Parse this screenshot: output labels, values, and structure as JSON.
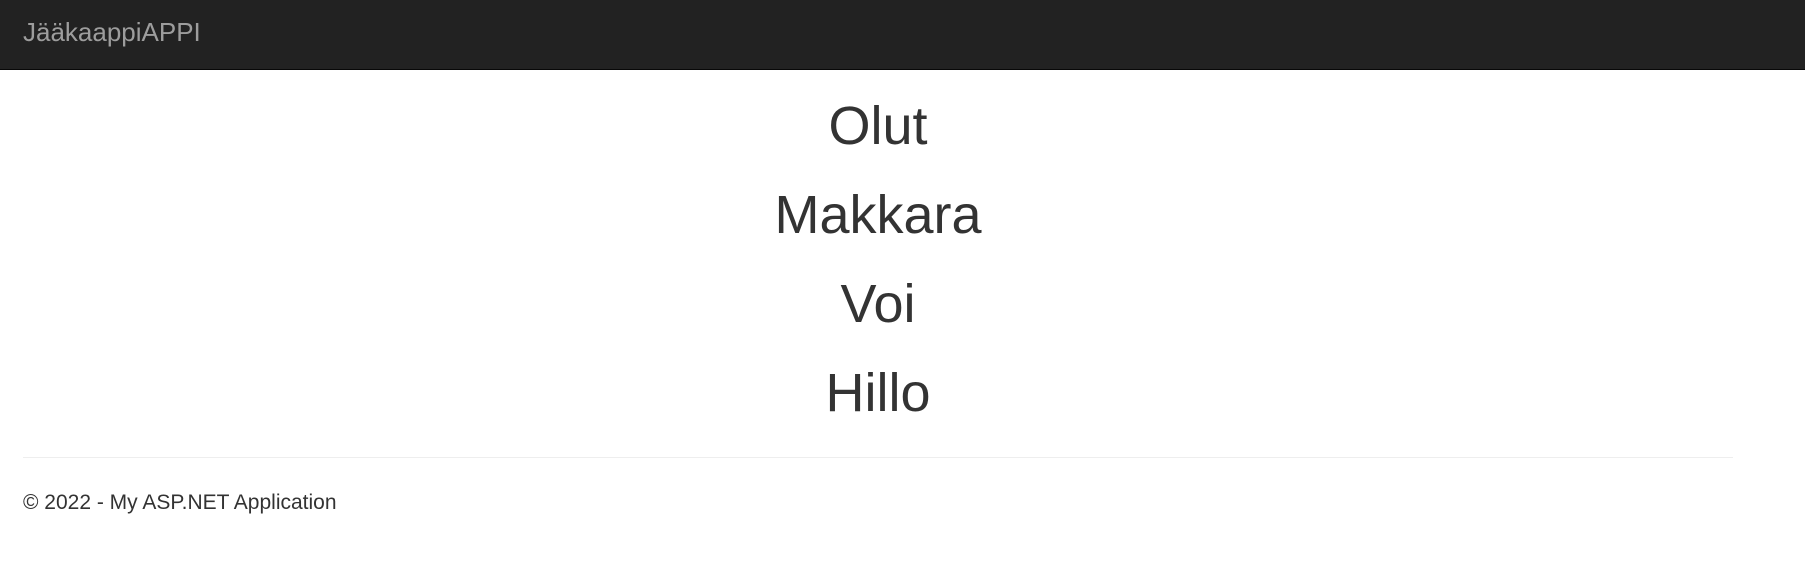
{
  "navbar": {
    "brand": "JääkaappiAPPI"
  },
  "main": {
    "items": [
      {
        "label": "Olut"
      },
      {
        "label": "Makkara"
      },
      {
        "label": "Voi"
      },
      {
        "label": "Hillo"
      }
    ]
  },
  "footer": {
    "text": "© 2022 - My ASP.NET Application"
  },
  "colors": {
    "navbar_background": "#222222",
    "brand_text": "#9d9d9d",
    "body_text": "#333333",
    "divider": "#eeeeee"
  }
}
